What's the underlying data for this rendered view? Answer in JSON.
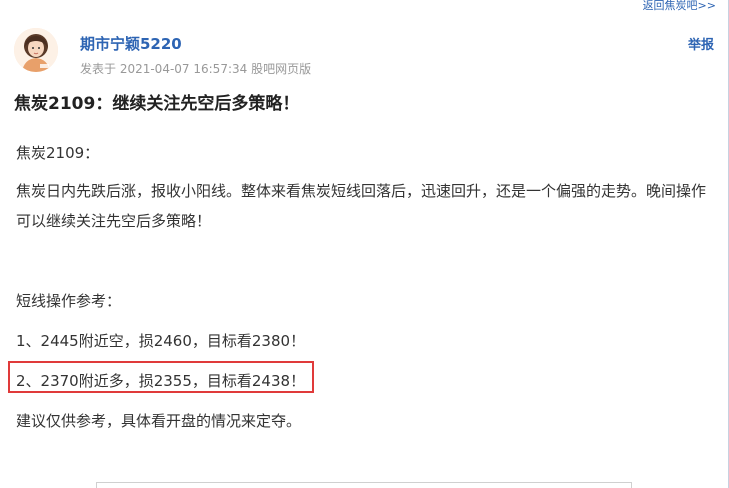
{
  "header": {
    "back_link": "返回焦炭吧>>"
  },
  "post": {
    "author": "期市宁颖5220",
    "meta": "发表于 2021-04-07 16:57:34 股吧网页版",
    "report": "举报",
    "title": "焦炭2109：继续关注先空后多策略！",
    "paragraphs": [
      "焦炭2109：",
      "焦炭日内先跌后涨，报收小阳线。整体来看焦炭短线回落后，迅速回升，还是一个偏强的走势。晚间操作可以继续关注先空后多策略！",
      "短线操作参考：",
      "1、2445附近空，损2460，目标看2380！",
      "2、2370附近多，损2355，目标看2438！",
      "建议仅供参考，具体看开盘的情况来定夺。"
    ]
  },
  "colors": {
    "link_blue": "#2d64b3",
    "highlight_red": "#e03a3a",
    "meta_gray": "#999999"
  }
}
